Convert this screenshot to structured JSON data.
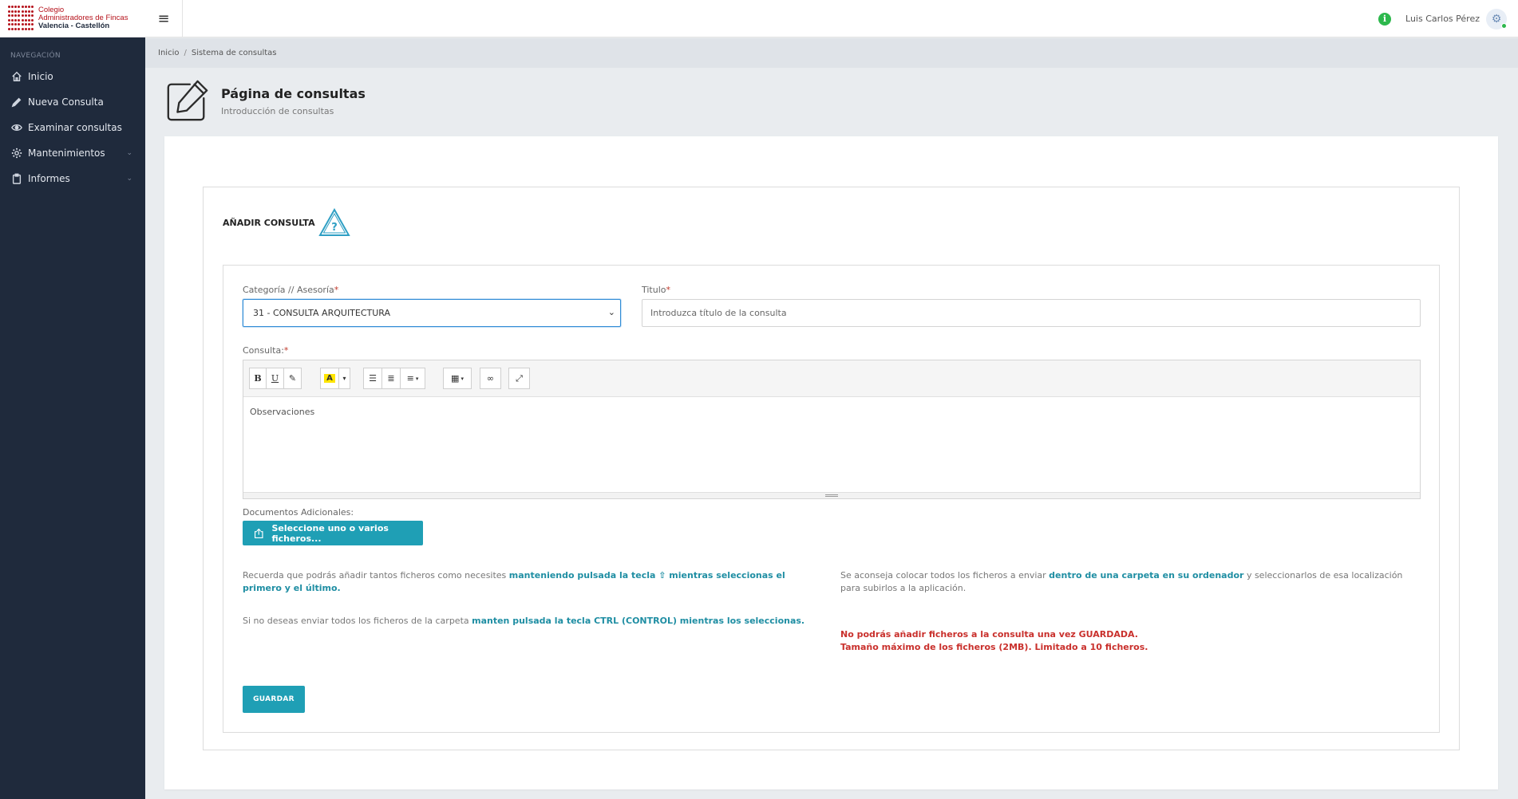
{
  "brand": {
    "line1": "Colegio",
    "line2": "Administradores de Fincas",
    "line3": "Valencia - Castellón"
  },
  "sidebar": {
    "section_title": "NAVEGACIÓN",
    "items": [
      {
        "label": "Inicio",
        "icon": "home-icon"
      },
      {
        "label": "Nueva Consulta",
        "icon": "pencil-icon"
      },
      {
        "label": "Examinar consultas",
        "icon": "eye-icon"
      },
      {
        "label": "Mantenimientos",
        "icon": "gear-icon",
        "has_submenu": true
      },
      {
        "label": "Informes",
        "icon": "clipboard-icon",
        "has_submenu": true
      }
    ]
  },
  "topbar": {
    "user_name": "Luis Carlos Pérez",
    "info_glyph": "i"
  },
  "breadcrumb": {
    "items": [
      "Inicio",
      "Sistema de consultas"
    ],
    "separator": "/"
  },
  "header": {
    "title": "Página de consultas",
    "subtitle": "Introducción de consultas"
  },
  "form": {
    "section_title": "AÑADIR CONSULTA",
    "category_label": "Categoría // Asesoría",
    "category_value": "31 - CONSULTA ARQUITECTURA",
    "title_label": "Titulo",
    "title_placeholder": "Introduzca título de la consulta",
    "consulta_label": "Consulta:",
    "required_mark": "*",
    "editor_placeholder": "Observaciones",
    "toolbar": {
      "bold": "B",
      "underline": "U"
    },
    "attachments_label": "Documentos Adicionales:",
    "upload_button": "Seleccione uno o varios ficheros...",
    "save_button": "GUARDAR"
  },
  "notes": {
    "n1_text": "Recuerda que podrás añadir tantos ficheros como necesites ",
    "n1_hl": "manteniendo pulsada la tecla ⇧ mientras seleccionas el primero y el último.",
    "n2_text": "Si no deseas enviar todos los ficheros de la carpeta ",
    "n2_hl": "manten pulsada la tecla CTRL (CONTROL) mientras los seleccionas.",
    "n3_text": "Se aconseja colocar todos los ficheros a enviar ",
    "n3_hl": "dentro de una carpeta en su ordenador",
    "n3_tail": " y seleccionarlos de esa localización para subirlos a la aplicación.",
    "warn1": "No podrás añadir ficheros a la consulta una vez GUARDADA.",
    "warn2": "Tamaño máximo de los ficheros (2MB). Limitado a 10 ficheros."
  },
  "colors": {
    "sidebar_bg": "#1f2a3c",
    "accent": "#1f9fb5",
    "brand_red": "#b5121b",
    "warning": "#c9302c"
  }
}
